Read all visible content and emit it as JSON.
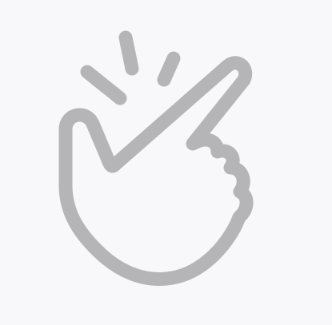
{
  "illustration": {
    "icon": "finger-snap-icon",
    "icon_color": "#b5b5b8",
    "background_color": "#f8f8fa"
  }
}
